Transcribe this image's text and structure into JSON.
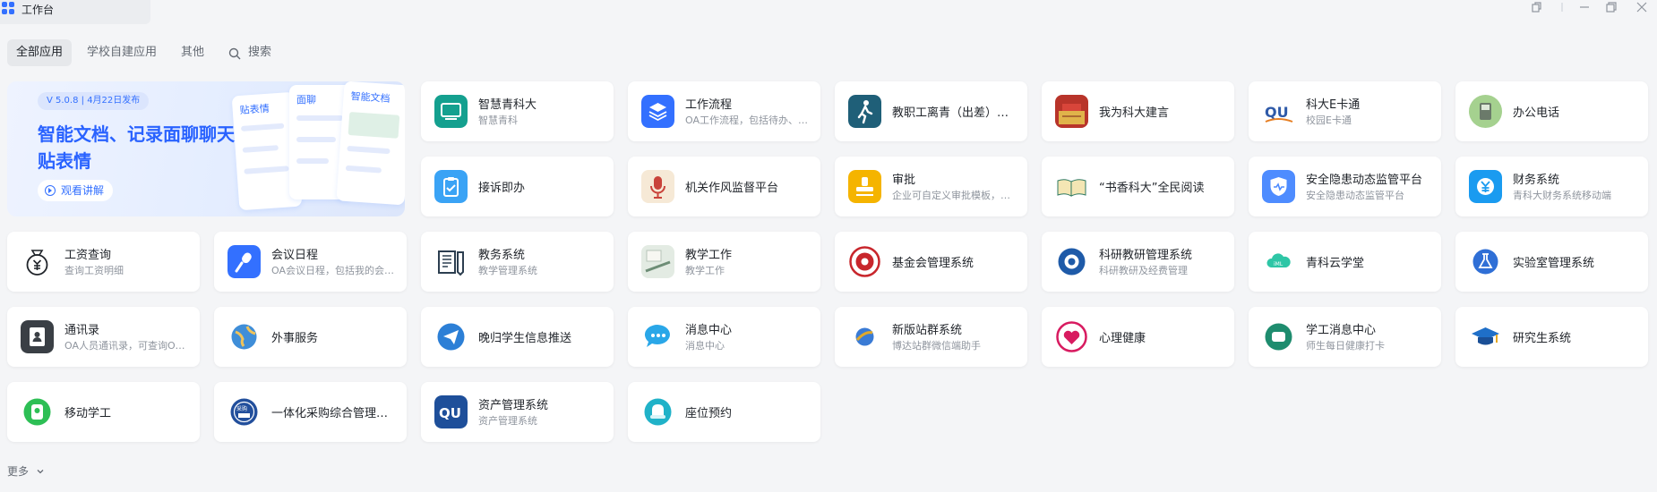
{
  "window": {
    "title": "工作台"
  },
  "tabs": [
    {
      "label": "全部应用"
    },
    {
      "label": "学校自建应用"
    },
    {
      "label": "其他"
    }
  ],
  "search": {
    "label": "搜索"
  },
  "banner": {
    "version": "V 5.0.8  |  4月22日发布",
    "title": "智能文档、记录面聊聊天贴表情",
    "button": "观看讲解",
    "mini_labels": [
      "贴表情",
      "面聊",
      "智能文档"
    ]
  },
  "apps": [
    {
      "name": "智慧青科大",
      "desc": "智慧青科",
      "icon": "smart-campus-icon",
      "color": "#14a08f"
    },
    {
      "name": "工作流程",
      "desc": "OA工作流程，包括待办、已办等",
      "icon": "workflow-layers-icon",
      "color": "#3370ff"
    },
    {
      "name": "教职工离青（出差）报备",
      "desc": "",
      "icon": "walking-person-icon",
      "color": "#1f5f78"
    },
    {
      "name": "我为科大建言",
      "desc": "",
      "icon": "building-photo-icon",
      "color": "#c0392b"
    },
    {
      "name": "科大E卡通",
      "desc": "校园E卡通",
      "icon": "qust-logo-icon",
      "color": "#2f5aa8"
    },
    {
      "name": "办公电话",
      "desc": "",
      "icon": "office-phone-icon",
      "color": "#9ccb86"
    },
    {
      "name": "接诉即办",
      "desc": "",
      "icon": "clipboard-icon",
      "color": "#3aa3f5"
    },
    {
      "name": "机关作风监督平台",
      "desc": "",
      "icon": "microphone-icon",
      "color": "#c9433a"
    },
    {
      "name": "审批",
      "desc": "企业可自定义审批模板，流程",
      "icon": "approval-stamp-icon",
      "color": "#f5b400"
    },
    {
      "name": "“书香科大”全民阅读",
      "desc": "",
      "icon": "open-book-icon",
      "color": "#2f7a62"
    },
    {
      "name": "安全隐患动态监管平台",
      "desc": "安全隐患动态监管平台",
      "icon": "security-shield-icon",
      "color": "#4e8cff"
    },
    {
      "name": "财务系统",
      "desc": "青科大财务系统移动端",
      "icon": "yuan-finance-icon",
      "color": "#1a9bf0"
    },
    {
      "name": "工资查询",
      "desc": "查询工资明细",
      "icon": "money-bag-icon",
      "color": "#1f2329"
    },
    {
      "name": "会议日程",
      "desc": "OA会议日程，包括我的会议等",
      "icon": "meeting-mic-icon",
      "color": "#3370ff"
    },
    {
      "name": "教务系统",
      "desc": "教学管理系统",
      "icon": "academic-ledger-icon",
      "color": "#2c3e50"
    },
    {
      "name": "教学工作",
      "desc": "教学工作",
      "icon": "teaching-notes-icon",
      "color": "#7fa28b"
    },
    {
      "name": "基金会管理系统",
      "desc": "",
      "icon": "foundation-seal-icon",
      "color": "#c8262c"
    },
    {
      "name": "科研教研管理系统",
      "desc": "科研教研及经费管理",
      "icon": "research-emblem-icon",
      "color": "#1e5aa8"
    },
    {
      "name": "青科云学堂",
      "desc": "",
      "icon": "cloud-classroom-icon",
      "color": "#2ec6a6"
    },
    {
      "name": "实验室管理系统",
      "desc": "",
      "icon": "laboratory-icon",
      "color": "#2f6fd6"
    },
    {
      "name": "通讯录",
      "desc": "OA人员通讯录，可查询OA人员",
      "icon": "contacts-book-icon",
      "color": "#3a3f45"
    },
    {
      "name": "外事服务",
      "desc": "",
      "icon": "globe-icon",
      "color": "#3f8ed8"
    },
    {
      "name": "晚归学生信息推送",
      "desc": "",
      "icon": "paper-plane-icon",
      "color": "#2c7fd6"
    },
    {
      "name": "消息中心",
      "desc": "消息中心",
      "icon": "chat-bubble-icon",
      "color": "#2aa7e8"
    },
    {
      "name": "新版站群系统",
      "desc": "博达站群微信端助手",
      "icon": "site-globe-icon",
      "color": "#e0a92b"
    },
    {
      "name": "心理健康",
      "desc": "",
      "icon": "heart-icon",
      "color": "#d81b60"
    },
    {
      "name": "学工消息中心",
      "desc": "师生每日健康打卡",
      "icon": "student-message-icon",
      "color": "#1e8c6e"
    },
    {
      "name": "研究生系统",
      "desc": "",
      "icon": "graduation-cap-icon",
      "color": "#1f6fc8"
    },
    {
      "name": "移动学工",
      "desc": "",
      "icon": "mobile-student-icon",
      "color": "#2dbf55"
    },
    {
      "name": "一体化采购综合管理平台",
      "desc": "",
      "icon": "procurement-seal-icon",
      "color": "#224f9c"
    },
    {
      "name": "资产管理系统",
      "desc": "资产管理系统",
      "icon": "qust-asset-icon",
      "color": "#1e4f9a"
    },
    {
      "name": "座位预约",
      "desc": "",
      "icon": "seat-reservation-icon",
      "color": "#20b2c8"
    }
  ],
  "more": {
    "label": "更多"
  }
}
